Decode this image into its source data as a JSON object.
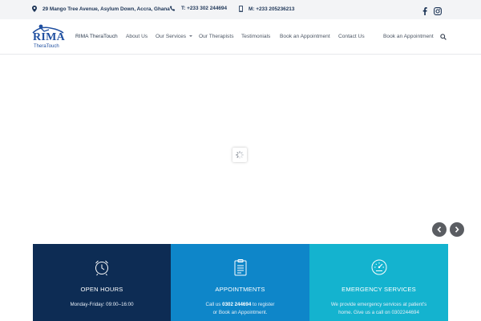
{
  "topbar": {
    "address": "29 Mango Tree Avenue, Asylum Down, Accra, Ghana",
    "phone": "T: +233 302 244694",
    "mobile": "M: +233 205236213",
    "social": [
      {
        "name": "facebook-icon",
        "glyph": "f"
      },
      {
        "name": "instagram-icon",
        "glyph": ""
      }
    ]
  },
  "header": {
    "logo": {
      "title": "RIMA",
      "subtitle": "TheraTouch"
    },
    "nav": [
      {
        "label": "RIMA TheraTouch"
      },
      {
        "label": "About Us"
      },
      {
        "label": "Our Services",
        "has_dropdown": true
      },
      {
        "label": "Our Therapists"
      },
      {
        "label": "Testimonials"
      },
      {
        "label": "Book an Appointment"
      },
      {
        "label": "Contact Us"
      },
      {
        "label": "Book an Appointment"
      }
    ],
    "search_icon": "search-icon"
  },
  "hero": {
    "loader_icon": "spinner-icon",
    "prev_icon": "chevron-left-icon",
    "next_icon": "chevron-right-icon"
  },
  "cards": [
    {
      "icon": "alarm-clock-icon",
      "title": "OPEN HOURS",
      "text": "Monday-Friday: 09:00–16:00",
      "color": "#0d2c54"
    },
    {
      "icon": "clipboard-icon",
      "title": "APPOINTMENTS",
      "text_prefix": "Call us ",
      "text_highlight": "0302 244694",
      "text_suffix": " to register",
      "text_line2": "or Book an Appointment.",
      "color": "#0e86c9"
    },
    {
      "icon": "gauge-icon",
      "title": "EMERGENCY SERVICES",
      "text": "We provide emergency services at patient's home. Give us a call on 0302244694",
      "color": "#14b3cf"
    }
  ],
  "colors": {
    "topbar_bg": "#f3f4f6",
    "navy": "#0d2c54",
    "blue": "#0e86c9",
    "cyan": "#14b3cf",
    "logo_blue": "#1f4fa0"
  }
}
